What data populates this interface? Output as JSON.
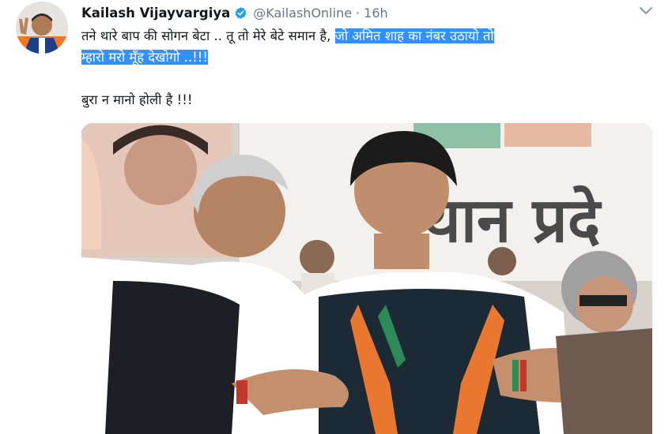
{
  "tweet": {
    "author_name": "Kailash Vijayvargiya",
    "handle": "@KailashOnline",
    "separator": "·",
    "time": "16h",
    "text_plain": "तने थारे बाप की सोगन बेटा .. तू तो मेरे बेटे समान है,",
    "text_hl1": "जो अमित शाह का नंबर उठायो तो",
    "text_hl2": "म्हारो मरो मूँह देखोगो ..!!!",
    "line2": "बुरा न मानो होली है !!!",
    "photo_text": "थान प्रदे"
  },
  "colors": {
    "highlight": "#3390ff",
    "verified": "#1da1f2",
    "secondary_text": "#657786"
  },
  "icons": [
    "verified-badge-icon",
    "chevron-down-icon"
  ]
}
